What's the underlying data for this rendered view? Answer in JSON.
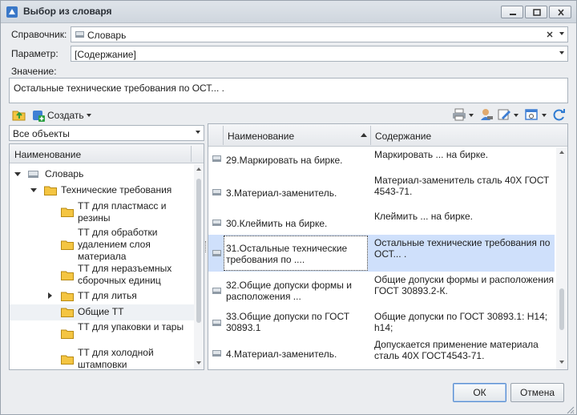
{
  "window": {
    "title": "Выбор из словаря"
  },
  "form": {
    "dictionary_label": "Справочник:",
    "dictionary_value": "Словарь",
    "parameter_label": "Параметр:",
    "parameter_value": "[Содержание]",
    "value_label": "Значение:",
    "value_text": "Остальные технические требования по ОСТ... ."
  },
  "toolbar": {
    "create_label": "Создать"
  },
  "filter": {
    "selected": "Все объекты"
  },
  "left_panel": {
    "header": "Наименование",
    "tree": [
      {
        "label": "Словарь"
      },
      {
        "label": "Технические требования"
      },
      {
        "label": "ТТ для пластмасс и резины"
      },
      {
        "label": "ТТ для обработки удалением слоя материала"
      },
      {
        "label": "ТТ для неразъемных сборочных единиц"
      },
      {
        "label": "ТТ для литья"
      },
      {
        "label": "Общие ТТ"
      },
      {
        "label": "ТТ для упаковки и тары"
      },
      {
        "label": "ТТ для холодной штамповки"
      }
    ]
  },
  "right_panel": {
    "col_name": "Наименование",
    "col_content": "Содержание",
    "rows": [
      {
        "name": "29.Маркировать на бирке.",
        "content": "Маркировать ... на бирке."
      },
      {
        "name": "3.Материал-заменитель.",
        "content": "Материал-заменитель сталь 40Х ГОСТ 4543-71."
      },
      {
        "name": "30.Клеймить на бирке.",
        "content": "Клеймить ... на бирке."
      },
      {
        "name": "31.Остальные технические требования по ....",
        "content": "Остальные технические требования по ОСТ... ."
      },
      {
        "name": "32.Общие допуски формы и расположения ...",
        "content": "Общие допуски формы и расположения ГОСТ 30893.2-К."
      },
      {
        "name": "33.Общие допуски по ГОСТ 30893.1",
        "content": "Общие допуски по ГОСТ 30893.1: H14; h14;"
      },
      {
        "name": "4.Материал-заменитель.",
        "content": "Допускается применение материала сталь 40Х ГОСТ4543-71."
      }
    ]
  },
  "buttons": {
    "ok": "ОК",
    "cancel": "Отмена"
  }
}
